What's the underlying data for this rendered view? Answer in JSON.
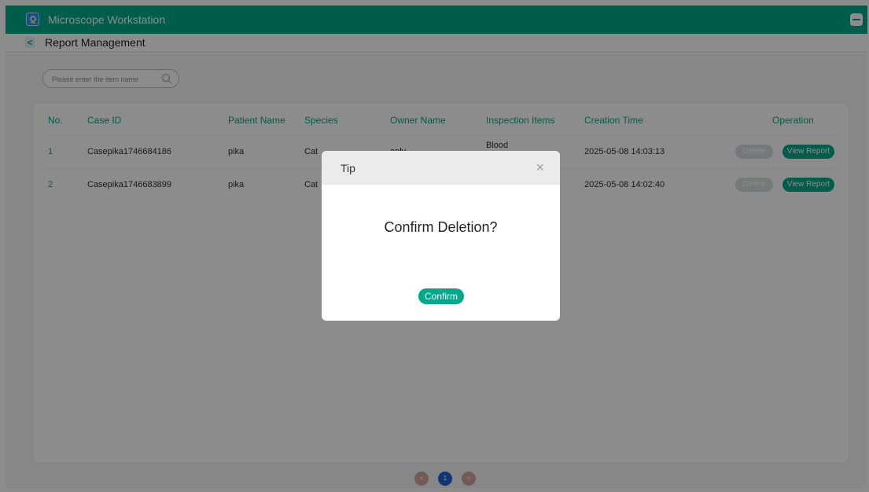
{
  "app": {
    "title": "Microscope Workstation"
  },
  "nav": {
    "back_label": "<",
    "title": "Report Management"
  },
  "search": {
    "placeholder": "Please enter the item name",
    "value": ""
  },
  "table": {
    "headers": [
      "No.",
      "Case ID",
      "Patient Name",
      "Species",
      "Owner Name",
      "Inspection Items",
      "Creation Time",
      "Operation"
    ],
    "rows": [
      {
        "no": "1",
        "case_id": "Casepika1746684186",
        "patient": "pika",
        "species": "Cat",
        "owner": "anlv",
        "inspection": "Blood Examination",
        "created": "2025-05-08 14:03:13",
        "delete_label": "Delete",
        "view_label": "View Report"
      },
      {
        "no": "2",
        "case_id": "Casepika1746683899",
        "patient": "pika",
        "species": "Cat",
        "owner": "",
        "inspection": "",
        "created": "2025-05-08 14:02:40",
        "delete_label": "Delete",
        "view_label": "View Report"
      }
    ]
  },
  "pagination": {
    "prev": "<",
    "current": "1",
    "next": ">"
  },
  "dialog": {
    "title": "Tip",
    "close": "×",
    "message": "Confirm Deletion?",
    "confirm_label": "Confirm"
  },
  "colors": {
    "accent": "#00a98a",
    "page_button": "#1e63d4"
  }
}
